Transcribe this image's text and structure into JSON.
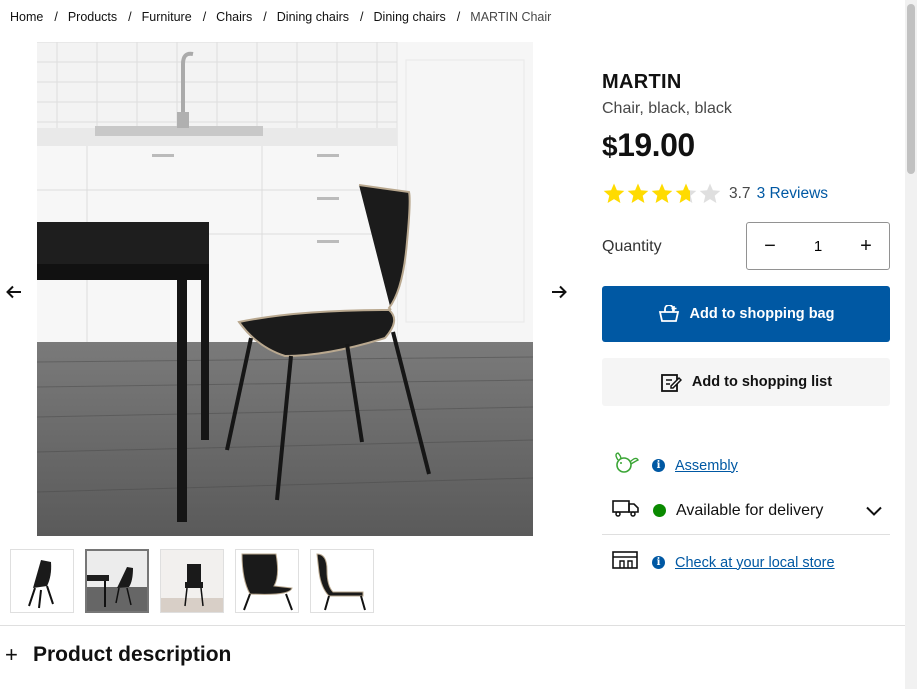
{
  "breadcrumb": {
    "items": [
      "Home",
      "Products",
      "Furniture",
      "Chairs",
      "Dining chairs",
      "Dining chairs"
    ],
    "current": "MARTIN Chair",
    "separator": "/"
  },
  "gallery": {
    "prev_icon": "arrow-left-icon",
    "next_icon": "arrow-right-icon",
    "thumbnail_count": 5,
    "active_thumbnail": 2
  },
  "product": {
    "name": "MARTIN",
    "subtitle": "Chair, black, black",
    "currency": "$",
    "price": "19.00",
    "rating": 3.7,
    "rating_text": "3.7",
    "reviews_text": "3 Reviews",
    "star_color": "#ffdb00"
  },
  "quantity": {
    "label": "Quantity",
    "value": "1",
    "minus": "−",
    "plus": "+"
  },
  "actions": {
    "add_to_bag": "Add to shopping bag",
    "add_to_list": "Add to shopping list",
    "primary_color": "#0058a3"
  },
  "services": {
    "assembly": "Assembly",
    "delivery": "Available for delivery",
    "delivery_status_color": "#0a8a00",
    "store": "Check at your local store"
  },
  "description": {
    "toggle": "+",
    "title": "Product description"
  }
}
